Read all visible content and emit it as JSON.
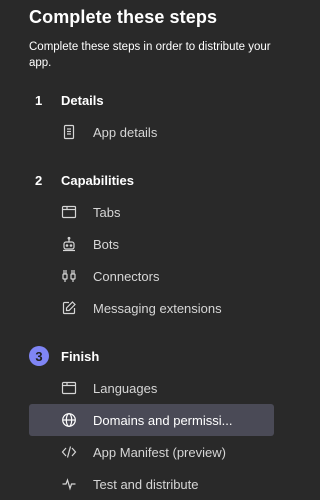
{
  "header": {
    "title": "Complete these steps",
    "subtitle": "Complete these steps in order to distribute your app."
  },
  "steps": [
    {
      "number": "1",
      "title": "Details",
      "items": [
        {
          "label": "App details",
          "icon": "document-icon"
        }
      ]
    },
    {
      "number": "2",
      "title": "Capabilities",
      "items": [
        {
          "label": "Tabs",
          "icon": "tab-icon"
        },
        {
          "label": "Bots",
          "icon": "bot-icon"
        },
        {
          "label": "Connectors",
          "icon": "connector-icon"
        },
        {
          "label": "Messaging extensions",
          "icon": "edit-icon"
        }
      ]
    },
    {
      "number": "3",
      "title": "Finish",
      "active": true,
      "items": [
        {
          "label": "Languages",
          "icon": "tab-icon"
        },
        {
          "label": "Domains and permissi...",
          "icon": "globe-icon",
          "selected": true
        },
        {
          "label": "App Manifest (preview)",
          "icon": "code-icon"
        },
        {
          "label": "Test and distribute",
          "icon": "pulse-icon"
        }
      ]
    }
  ],
  "colors": {
    "background": "#292929",
    "accent": "#7f85f5",
    "selected_bg": "#4a4a56"
  }
}
